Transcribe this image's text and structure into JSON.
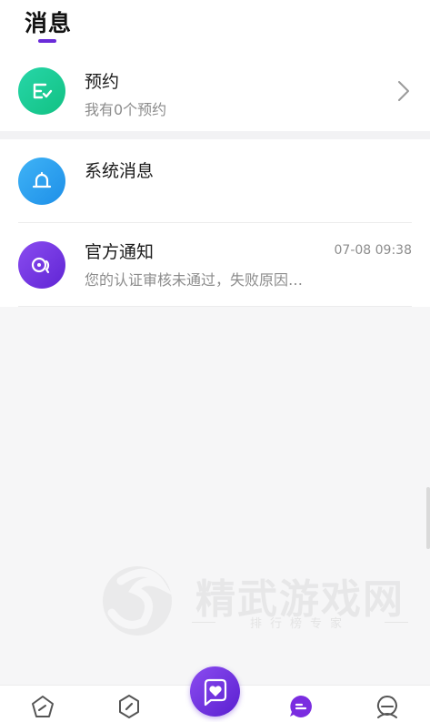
{
  "header": {
    "title": "消息"
  },
  "reserve": {
    "title": "预约",
    "subtitle": "我有0个预约"
  },
  "system": {
    "title": "系统消息"
  },
  "official": {
    "title": "官方通知",
    "time": "07-08 09:38",
    "preview": "您的认证审核未通过，失败原因…"
  },
  "watermark": {
    "brand": "精武游戏网",
    "tagline": "排行榜专家"
  },
  "tabs": [
    "home-icon",
    "compass-icon",
    "heart-chat-icon",
    "message-icon",
    "profile-icon"
  ],
  "colors": {
    "accent": "#6a2bd9",
    "green": "#12c183",
    "blue": "#1e8fe8",
    "purple": "#6025d4"
  }
}
